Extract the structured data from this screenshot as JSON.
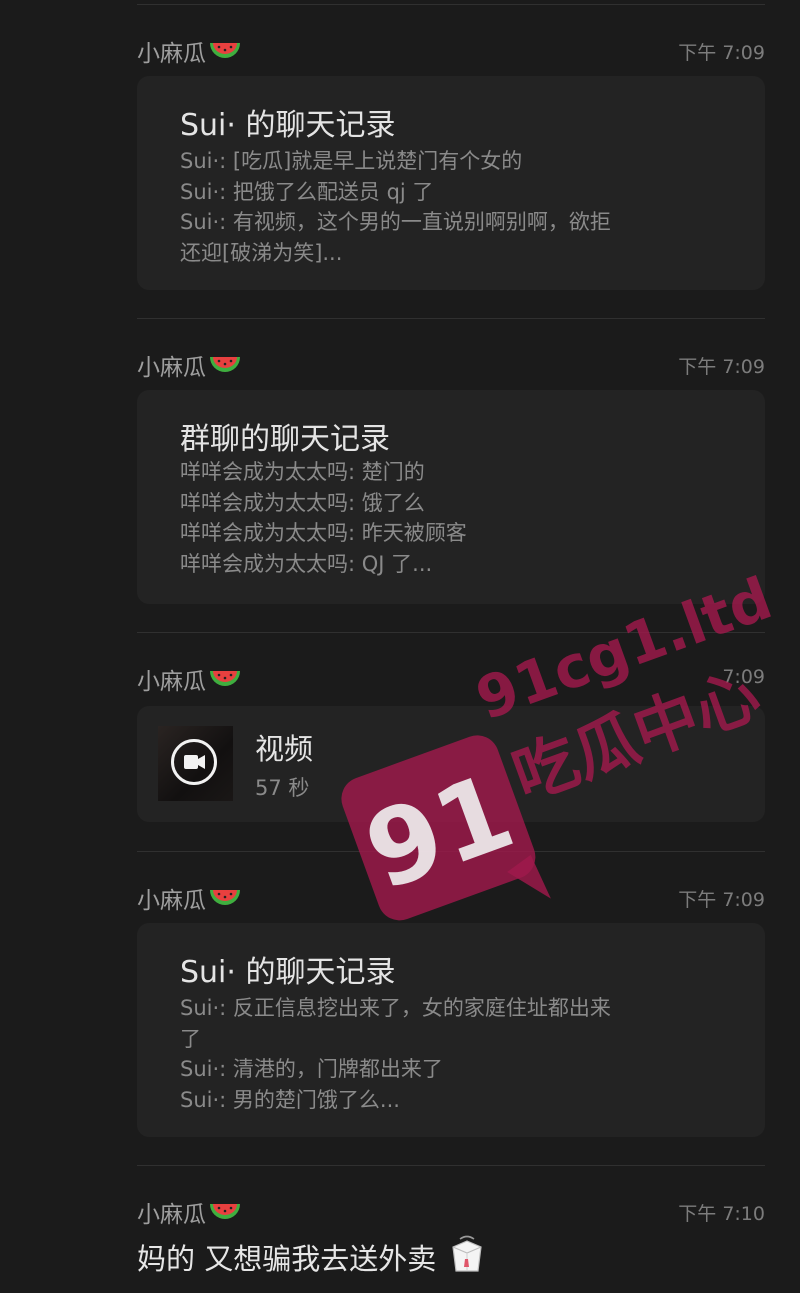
{
  "sender_name": "小麻瓜",
  "messages": [
    {
      "type": "chat_record",
      "time": "下午 7:09",
      "title": "Sui· 的聊天记录",
      "lines": [
        "Sui·: [吃瓜]就是早上说楚门有个女的",
        "Sui·: 把饿了么配送员 qj 了",
        "Sui·: 有视频，这个男的一直说别啊别啊，欲拒\n还迎[破涕为笑]..."
      ]
    },
    {
      "type": "chat_record",
      "time": "下午 7:09",
      "title": "群聊的聊天记录",
      "lines": [
        "咩咩会成为太太吗: 楚门的",
        "咩咩会成为太太吗: 饿了么",
        "咩咩会成为太太吗: 昨天被顾客",
        "咩咩会成为太太吗: QJ 了..."
      ]
    },
    {
      "type": "video",
      "time": "7:09",
      "title": "视频",
      "duration": "57 秒"
    },
    {
      "type": "chat_record",
      "time": "下午 7:09",
      "title": "Sui· 的聊天记录",
      "lines": [
        "Sui·: 反正信息挖出来了，女的家庭住址都出来\n了",
        "Sui·: 清港的，门牌都出来了",
        "Sui·: 男的楚门饿了么..."
      ]
    },
    {
      "type": "text",
      "time": "下午 7:10",
      "text": "妈的 又想骗我去送外卖"
    }
  ],
  "watermark": {
    "number": "91",
    "domain": "91cg1.ltd",
    "brand": "吃瓜中心",
    "color": "#a01a4c"
  },
  "icons": [
    "watermelon-icon",
    "video-camera-icon",
    "takeout-box-icon"
  ]
}
